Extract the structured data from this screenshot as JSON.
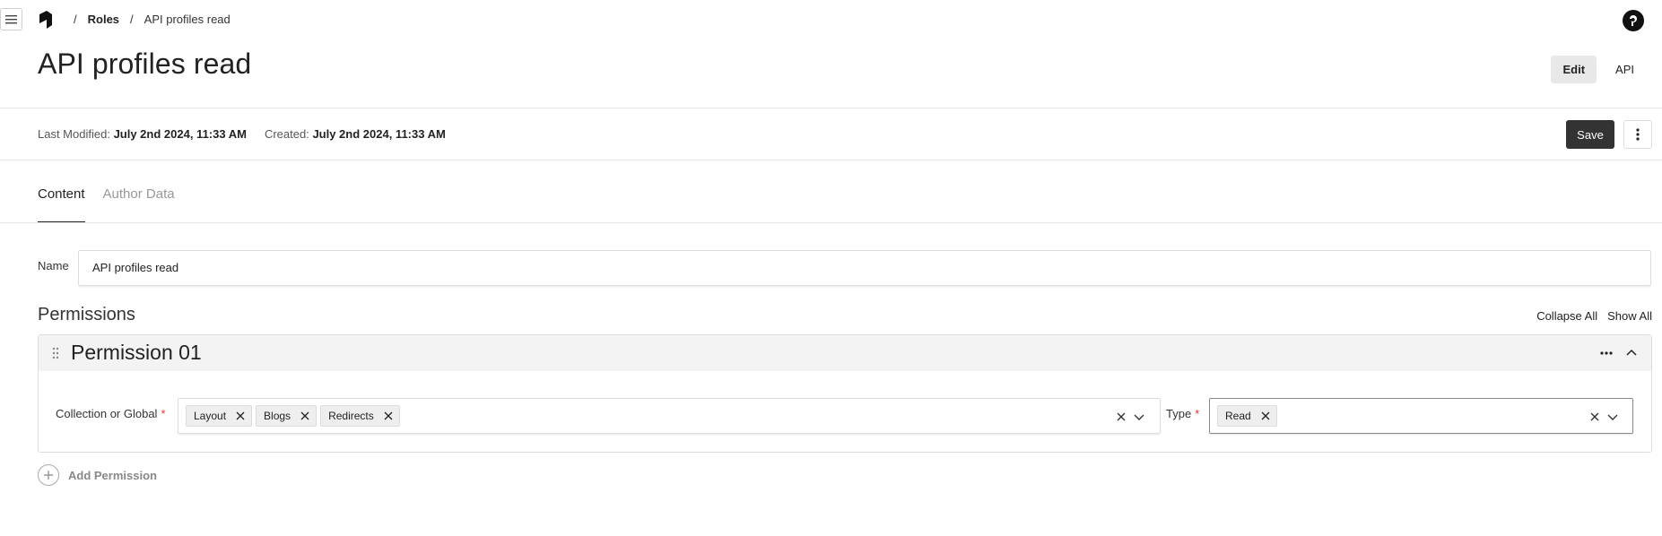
{
  "nav": {
    "breadcrumb": [
      "Roles",
      "API profiles read"
    ],
    "separator": "/"
  },
  "page": {
    "title": "API profiles read",
    "view_tabs": [
      "Edit",
      "API"
    ]
  },
  "meta": {
    "last_modified_label": "Last Modified:",
    "last_modified_value": "July 2nd 2024, 11:33 AM",
    "created_label": "Created:",
    "created_value": "July 2nd 2024, 11:33 AM"
  },
  "toolbar": {
    "save_label": "Save"
  },
  "tabs": [
    "Content",
    "Author Data"
  ],
  "form": {
    "name_label": "Name",
    "name_value": "API profiles read"
  },
  "permissions": {
    "title": "Permissions",
    "collapse_all": "Collapse All",
    "show_all": "Show All",
    "items": [
      {
        "title": "Permission 01",
        "collection_label": "Collection or Global",
        "collection_values": [
          "Layout",
          "Blogs",
          "Redirects"
        ],
        "type_label": "Type",
        "type_values": [
          "Read"
        ]
      }
    ],
    "add_label": "Add Permission"
  },
  "colors": {
    "primary_button": "#333333",
    "required": "#dd3333"
  }
}
